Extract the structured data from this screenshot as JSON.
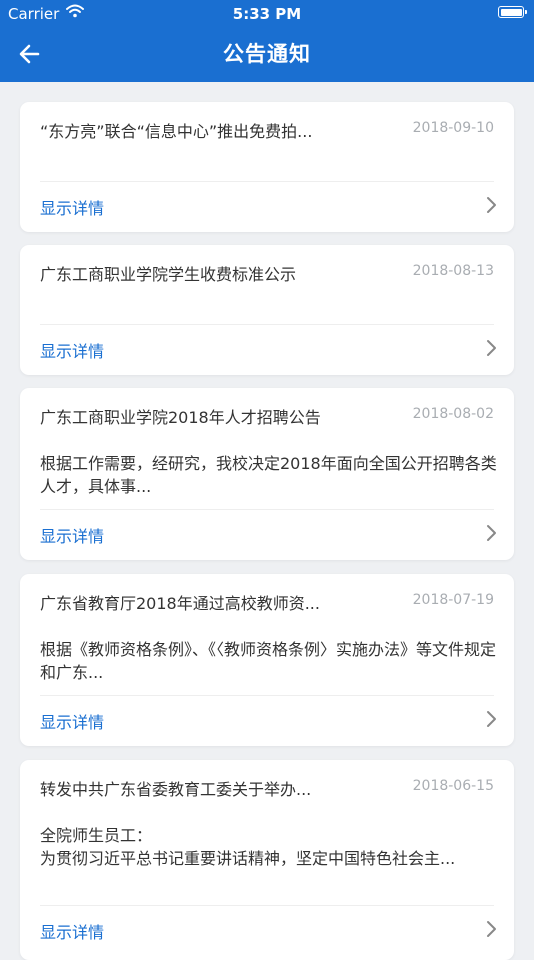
{
  "status_bar": {
    "carrier": "Carrier",
    "time": "5:33 PM"
  },
  "header": {
    "title": "公告通知"
  },
  "colors": {
    "primary": "#1a6fd1",
    "background": "#eef0f3",
    "date": "#a9adb2"
  },
  "notices": [
    {
      "title": "“东方亮”联合“信息中心”推出免费拍...",
      "date": "2018-09-10",
      "summary": "",
      "detail_label": "显示详情"
    },
    {
      "title": "广东工商职业学院学生收费标准公示",
      "date": "2018-08-13",
      "summary": "",
      "detail_label": "显示详情"
    },
    {
      "title": "广东工商职业学院2018年人才招聘公告",
      "date": "2018-08-02",
      "summary": "根据工作需要，经研究，我校决定2018年面向全国公开招聘各类人才，具体事...",
      "detail_label": "显示详情"
    },
    {
      "title": "广东省教育厅2018年通过高校教师资...",
      "date": "2018-07-19",
      "summary": "根据《教师资格条例》、《〈教师资格条例〉实施办法》等文件规定和广东...",
      "detail_label": "显示详情"
    },
    {
      "title": "转发中共广东省委教育工委关于举办...",
      "date": "2018-06-15",
      "summary": "全院师生员工：\n为贯彻习近平总书记重要讲话精神，坚定中国特色社会主...",
      "detail_label": "显示详情"
    }
  ]
}
